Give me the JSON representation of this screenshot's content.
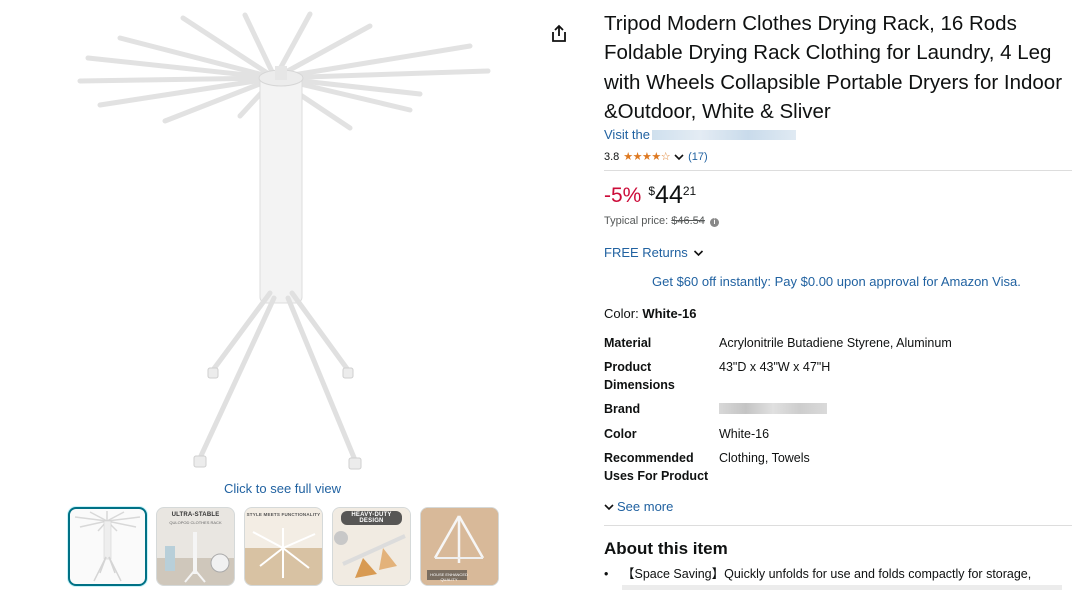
{
  "media": {
    "click_full_view": "Click to see full view",
    "thumbnails": [
      {
        "caption": "",
        "sub": ""
      },
      {
        "caption": "ULTRA-STABLE",
        "sub": "QULOPOD CLOTHES RACK"
      },
      {
        "caption": "STYLE MEETS FUNCTIONALITY",
        "sub": ""
      },
      {
        "caption": "HEAVY-DUTY DESIGN",
        "sub": ""
      },
      {
        "caption": "",
        "sub": "HOUSE ENHANCED QUALITY"
      }
    ]
  },
  "product": {
    "title": "Tripod Modern Clothes Drying Rack, 16 Rods Foldable Drying Rack Clothing for Laundry, 4 Leg with Wheels Collapsible Portable Dryers for Indoor &Outdoor, White & Sliver",
    "visit_prefix": "Visit the",
    "rating_value": "3.8",
    "stars": "★★★★☆",
    "rating_count": "(17)",
    "discount": "-5%",
    "price_currency": "$",
    "price_whole": "44",
    "price_fraction": "21",
    "typical_label": "Typical price:",
    "typical_price": "$46.54",
    "free_returns": "FREE Returns",
    "promo": "Get $60 off instantly: Pay $0.00 upon approval for Amazon Visa.",
    "color_label": "Color:",
    "color_value": "White-16",
    "specs": [
      {
        "key": "Material",
        "value": "Acrylonitrile Butadiene Styrene, Aluminum"
      },
      {
        "key": "Product Dimensions",
        "value": "43\"D x 43\"W x 47\"H"
      },
      {
        "key": "Brand",
        "value": ""
      },
      {
        "key": "Color",
        "value": "White-16"
      },
      {
        "key": "Recommended Uses For Product",
        "value": "Clothing, Towels"
      }
    ],
    "see_more": "See more",
    "about_title": "About this item",
    "bullet_1": "【Space Saving】Quickly unfolds for use and folds compactly for storage,"
  },
  "colors": {
    "link": "#2162a1",
    "discount": "#cc0c39",
    "star": "#de7921",
    "active_thumb": "#007185"
  },
  "icons": [
    "share-icon",
    "chevron-down-icon",
    "info-icon"
  ]
}
